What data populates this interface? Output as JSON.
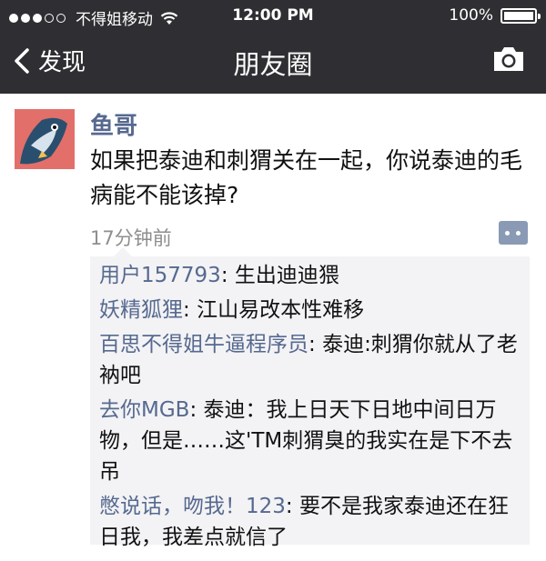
{
  "status_bar": {
    "carrier": "不得姐移动",
    "time": "12:00 PM",
    "battery": "100%",
    "battery_level": 1.0
  },
  "nav": {
    "back_label": "发现",
    "title": "朋友圈",
    "camera_icon": "camera-icon"
  },
  "post": {
    "author": "鱼哥",
    "content": "如果把泰迪和刺猬关在一起，你说泰迪的毛病能不能该掉?",
    "time_ago": "17分钟前",
    "comments": [
      {
        "name": "用户157793",
        "sep": ": ",
        "text": "生出迪迪猥"
      },
      {
        "name": "妖精狐狸",
        "sep": ": ",
        "text": "江山易改本性难移"
      },
      {
        "name": "百思不得姐牛逼程序员",
        "sep": ": ",
        "text": "泰迪:刺猬你就从了老衲吧"
      },
      {
        "name": "去你MGB",
        "sep": ": ",
        "text": "泰迪：我上日天下日地中间日万物，但是……这'TM刺猬臭的我实在是下不去吊"
      },
      {
        "name": "憋说话，吻我！123",
        "sep": ": ",
        "text": "要不是我家泰迪还在狂日我，我差点就信了"
      }
    ]
  },
  "colors": {
    "nav_bg": "#2f2f33",
    "author_name": "#56698f",
    "comments_bg": "#f3f3f5"
  }
}
